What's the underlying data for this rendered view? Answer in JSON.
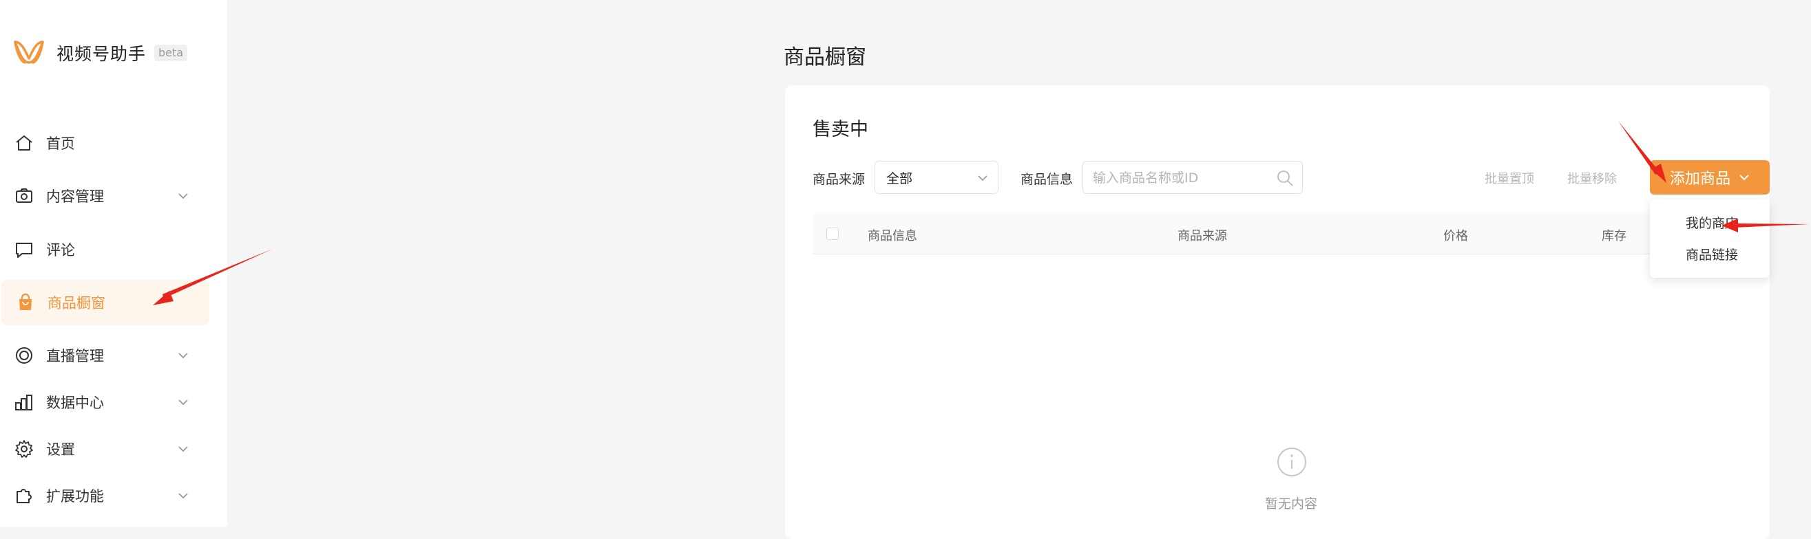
{
  "brand": {
    "name": "视频号助手",
    "badge": "beta",
    "logo_color": "#f3973e"
  },
  "sidebar": {
    "items": [
      {
        "label": "首页",
        "icon": "home-icon",
        "has_submenu": false,
        "active": false
      },
      {
        "label": "内容管理",
        "icon": "camera-icon",
        "has_submenu": true,
        "active": false
      },
      {
        "label": "评论",
        "icon": "comment-icon",
        "has_submenu": false,
        "active": false
      },
      {
        "label": "商品橱窗",
        "icon": "shopping-bag-icon",
        "has_submenu": false,
        "active": true
      },
      {
        "label": "直播管理",
        "icon": "live-icon",
        "has_submenu": true,
        "active": false
      },
      {
        "label": "数据中心",
        "icon": "chart-icon",
        "has_submenu": true,
        "active": false
      },
      {
        "label": "设置",
        "icon": "gear-icon",
        "has_submenu": true,
        "active": false
      },
      {
        "label": "扩展功能",
        "icon": "puzzle-icon",
        "has_submenu": true,
        "active": false
      }
    ]
  },
  "page": {
    "title": "商品橱窗"
  },
  "card": {
    "section_title": "售卖中",
    "filters": {
      "source_label": "商品来源",
      "source_value": "全部",
      "info_label": "商品信息",
      "search_placeholder": "输入商品名称或ID"
    },
    "actions": {
      "batch_top": "批量置顶",
      "batch_remove": "批量移除",
      "add_product": "添加商品"
    },
    "table": {
      "columns": [
        "商品信息",
        "商品来源",
        "价格",
        "库存"
      ]
    },
    "empty": {
      "text": "暂无内容"
    }
  },
  "dropdown": {
    "items": [
      "我的商店",
      "商品链接"
    ]
  },
  "colors": {
    "accent": "#f3973e",
    "annotation_arrow": "#e8251c"
  }
}
